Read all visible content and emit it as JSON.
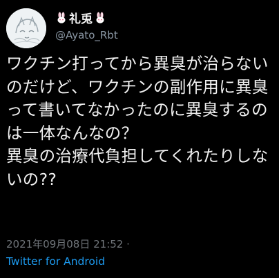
{
  "user": {
    "display_name": "礼兎",
    "handle": "@Ayato_Rbt",
    "name_icons": [
      "rabbit-icon",
      "rabbit-icon"
    ]
  },
  "tweet": {
    "text": "ワクチン打ってから異臭が治らないのだけど、ワクチンの副作用に異臭って書いてなかったのに異臭するのは一体なんなの？\n異臭の治療代負担してくれたりしないの??",
    "timestamp": "2021年09月08日 21:52 ·",
    "source": "Twitter for Android"
  },
  "colors": {
    "background": "#000000",
    "text": "#f0f0f0",
    "secondary": "#8b98a5",
    "link": "#1d9bf0"
  }
}
